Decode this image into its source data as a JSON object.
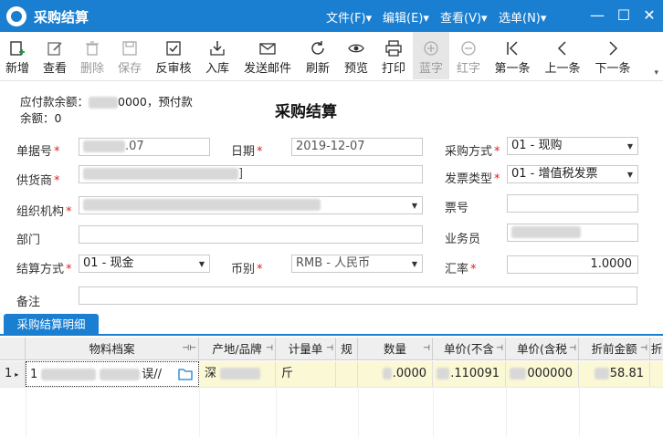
{
  "window": {
    "title": "采购结算",
    "menus": [
      "文件(F)▾",
      "编辑(E)▾",
      "查看(V)▾",
      "选单(N)▾"
    ],
    "controls": {
      "minimize": "—",
      "maximize": "☐",
      "close": "✕"
    }
  },
  "toolbar": {
    "items": [
      {
        "label": "新增",
        "icon": "add-doc-icon"
      },
      {
        "label": "查看",
        "icon": "edit-icon"
      },
      {
        "label": "删除",
        "icon": "trash-icon"
      },
      {
        "label": "保存",
        "icon": "save-icon"
      },
      {
        "label": "反审核",
        "icon": "unaudit-icon"
      },
      {
        "label": "入库",
        "icon": "inbound-icon"
      },
      {
        "label": "发送邮件",
        "icon": "mail-icon"
      },
      {
        "label": "刷新",
        "icon": "refresh-icon"
      },
      {
        "label": "预览",
        "icon": "eye-icon"
      },
      {
        "label": "打印",
        "icon": "printer-icon"
      },
      {
        "label": "蓝字",
        "icon": "plus-circle-icon"
      },
      {
        "label": "红字",
        "icon": "minus-circle-icon"
      },
      {
        "label": "第一条",
        "icon": "first-icon"
      },
      {
        "label": "上一条",
        "icon": "prev-icon"
      },
      {
        "label": "下一条",
        "icon": "next-icon"
      }
    ],
    "more": "▾"
  },
  "summary": {
    "line1_prefix": "应付款余额：",
    "line1_value": "0000，预付款",
    "line2": "余额：0"
  },
  "form": {
    "title": "采购结算",
    "bill_no": {
      "label": "单据号",
      "value": ".07"
    },
    "date": {
      "label": "日期",
      "value": "2019-12-07"
    },
    "purchase_method": {
      "label": "采购方式",
      "value": "01 - 现购"
    },
    "supplier": {
      "label": "供货商",
      "value": "]"
    },
    "invoice_type": {
      "label": "发票类型",
      "value": "01 - 增值税发票"
    },
    "org": {
      "label": "组织机构",
      "value": ""
    },
    "ticket_no": {
      "label": "票号",
      "value": ""
    },
    "dept": {
      "label": "部门",
      "value": ""
    },
    "salesman": {
      "label": "业务员",
      "value": ""
    },
    "settle_method": {
      "label": "结算方式",
      "value": "01 - 现金"
    },
    "currency": {
      "label": "币别",
      "value": "RMB - 人民币"
    },
    "rate": {
      "label": "汇率",
      "value": "1.0000"
    },
    "remark": {
      "label": "备注",
      "value": ""
    }
  },
  "details": {
    "tab": "采购结算明细",
    "columns": [
      "物料档案",
      "产地/品牌",
      "计量单",
      "规",
      "数量",
      "单价(不含",
      "单价(含税",
      "折前金额",
      "折"
    ],
    "rows": [
      {
        "idx": "1",
        "material": "1",
        "material_tail": "误//",
        "origin": "深",
        "unit": "斤",
        "qty": ".0000",
        "price_ex": ".110091",
        "price_in": "000000",
        "amount": "58.81"
      }
    ]
  }
}
